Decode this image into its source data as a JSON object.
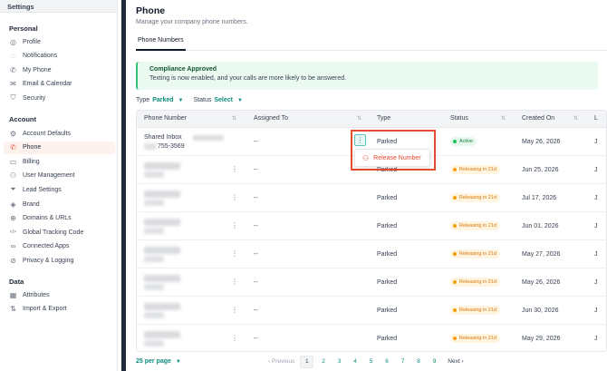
{
  "sidebar": {
    "header": "Settings",
    "sections": [
      {
        "title": "Personal",
        "items": [
          {
            "label": "Profile",
            "icon": "profile-icon"
          },
          {
            "label": "Notifications",
            "icon": "bell-icon"
          },
          {
            "label": "My Phone",
            "icon": "phone-icon"
          },
          {
            "label": "Email & Calendar",
            "icon": "mail-icon"
          },
          {
            "label": "Security",
            "icon": "shield-icon"
          }
        ]
      },
      {
        "title": "Account",
        "items": [
          {
            "label": "Account Defaults",
            "icon": "sliders-icon"
          },
          {
            "label": "Phone",
            "icon": "phone-icon",
            "active": true
          },
          {
            "label": "Billing",
            "icon": "billing-icon"
          },
          {
            "label": "User Management",
            "icon": "users-icon"
          },
          {
            "label": "Lead Settings",
            "icon": "filter-icon"
          },
          {
            "label": "Brand",
            "icon": "brand-icon"
          },
          {
            "label": "Domains & URLs",
            "icon": "globe-icon"
          },
          {
            "label": "Global Tracking Code",
            "icon": "code-icon"
          },
          {
            "label": "Connected Apps",
            "icon": "link-icon"
          },
          {
            "label": "Privacy & Logging",
            "icon": "privacy-icon"
          }
        ]
      },
      {
        "title": "Data",
        "items": [
          {
            "label": "Attributes",
            "icon": "attributes-icon"
          },
          {
            "label": "Import & Export",
            "icon": "import-export-icon"
          }
        ]
      }
    ]
  },
  "page": {
    "title": "Phone",
    "subtitle": "Manage your company phone numbers.",
    "tab": "Phone Numbers"
  },
  "alert": {
    "title": "Compliance Approved",
    "text": "Texting is now enabled, and your calls are more likely to be answered."
  },
  "filters": {
    "type_label": "Type",
    "type_value": "Parked",
    "status_label": "Status",
    "status_value": "Select"
  },
  "table": {
    "headers": [
      "Phone Number",
      "Assigned To",
      "Type",
      "Status",
      "Created On",
      "L"
    ],
    "rows": [
      {
        "name": "Shared Inbox",
        "number": "755-3569",
        "assigned": "--",
        "type": "Parked",
        "status": "Active",
        "created": "May 26, 2026",
        "last": "J"
      },
      {
        "name": "",
        "number": "",
        "assigned": "--",
        "type": "Parked",
        "status": "Releasing in 21d",
        "created": "Jun 25, 2026",
        "last": "J"
      },
      {
        "name": "",
        "number": "",
        "assigned": "--",
        "type": "Parked",
        "status": "Releasing in 21d",
        "created": "Jul 17, 2026",
        "last": "J"
      },
      {
        "name": "",
        "number": "",
        "assigned": "--",
        "type": "Parked",
        "status": "Releasing in 21d",
        "created": "Jun 01, 2026",
        "last": "J"
      },
      {
        "name": "",
        "number": "",
        "assigned": "--",
        "type": "Parked",
        "status": "Releasing in 21d",
        "created": "May 27, 2026",
        "last": "J"
      },
      {
        "name": "",
        "number": "",
        "assigned": "--",
        "type": "Parked",
        "status": "Releasing in 21d",
        "created": "May 26, 2026",
        "last": "J"
      },
      {
        "name": "",
        "number": "",
        "assigned": "--",
        "type": "Parked",
        "status": "Releasing in 21d",
        "created": "Jun 30, 2026",
        "last": "J"
      },
      {
        "name": "",
        "number": "",
        "assigned": "--",
        "type": "Parked",
        "status": "Releasing in 21d",
        "created": "May 29, 2026",
        "last": "J"
      }
    ]
  },
  "menu": {
    "release_label": "Release Number"
  },
  "footer": {
    "per_page": "25 per page",
    "previous": "Previous",
    "pages": [
      "1",
      "2",
      "3",
      "4",
      "5",
      "6",
      "7",
      "8",
      "9"
    ],
    "current_page": "1",
    "next": "Next"
  },
  "colors": {
    "accent": "#0f8a7e",
    "active_nav": "#e8603c",
    "danger": "#e54b2e",
    "success": "#22c55e",
    "warning": "#f59e0b"
  }
}
